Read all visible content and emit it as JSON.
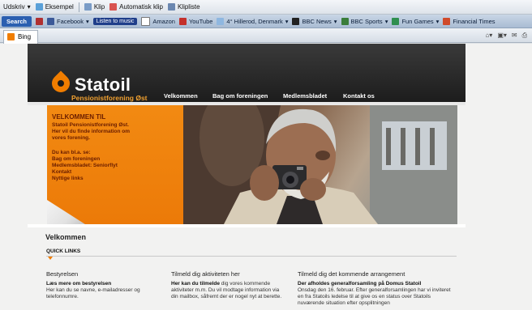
{
  "toolbar1": {
    "items": [
      "Udskriv",
      "Eksempel",
      "Klip",
      "Automatisk klip",
      "Klipliste"
    ]
  },
  "toolbar2": {
    "search_label": "Search",
    "facebook": "Facebook",
    "listen": "Listen to music",
    "links": [
      "Amazon",
      "YouTube",
      "4° Hillerod, Denmark",
      "BBC News",
      "BBC Sports",
      "Fun Games",
      "Financial Times"
    ]
  },
  "tab": {
    "label": "Bing"
  },
  "site": {
    "logo": "Statoil",
    "logo_sub": "Pensionistforening Øst",
    "nav": [
      "Velkommen",
      "Bag om foreningen",
      "Medlemsbladet",
      "Kontakt os"
    ],
    "hero": {
      "title": "VELKOMMEN TIL",
      "line1": "Statoil Pensionistforening Øst.",
      "line2": "Her vil du finde information om",
      "line3": "vores forening.",
      "find_label": "Du kan bl.a. se:",
      "links": [
        "Bag om foreningen",
        "Medlemsbladet: Seniorflyt",
        "Kontakt",
        "Nyttige links"
      ]
    },
    "welcome": "Velkommen",
    "quicklinks": "QUICK LINKS",
    "columns": [
      {
        "header": "Bestyrelsen",
        "bold": "Læs mere om bestyrelsen",
        "text": "Her kan du se navne, e-mailadresser og telefonnumre."
      },
      {
        "header": "Tilmeld dig aktiviteten her",
        "bold": "Her kan du tilmelde",
        "text": "dig vores kommende aktiviteter m.m. Du vil modtage information via din mailbox, såfremt der er nogel nyt at berette."
      },
      {
        "header": "Tilmeld dig det kommende arrangement",
        "bold": "Der afholdes generalforsamling på Domus Statoil",
        "text": "Onsdag den 16. februar. Efter generalforsamlingen har vi inviteret en fra Statoils ledelse til at give os en status over Statoils nuværende situation efter opsplitningen"
      }
    ]
  },
  "colors": {
    "brand_orange": "#f07d00",
    "header_dark": "#1b1b1b"
  }
}
